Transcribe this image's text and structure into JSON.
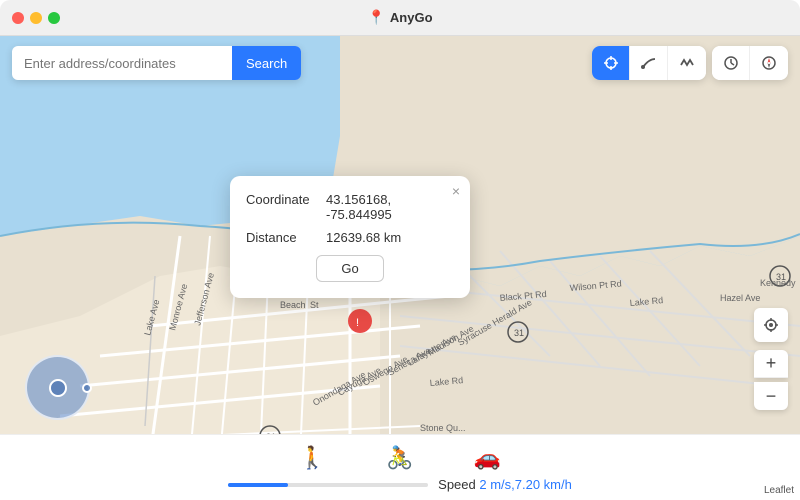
{
  "titleBar": {
    "title": "AnyGo",
    "pinIcon": "📍"
  },
  "searchBar": {
    "placeholder": "Enter address/coordinates",
    "searchLabel": "Search"
  },
  "controls": {
    "crosshair": "⊕",
    "route1": "↩",
    "route2": "〜",
    "history": "🕐",
    "compass": "◎",
    "group1Icons": [
      "crosshair",
      "curve",
      "wave"
    ],
    "group2Icons": [
      "clock",
      "compass"
    ]
  },
  "popup": {
    "closeLabel": "×",
    "coordinateLabel": "Coordinate",
    "coordinateValue": "43.156168, -75.844995",
    "distanceLabel": "Distance",
    "distanceValue": "12639.68 km",
    "goLabel": "Go"
  },
  "bottomPanel": {
    "transportModes": [
      {
        "icon": "🚶",
        "name": "walk"
      },
      {
        "icon": "🚴",
        "name": "bike"
      },
      {
        "icon": "🚗",
        "name": "car"
      }
    ],
    "speedLabel": "Speed",
    "speedValue": "2 m/s,7.20 km/h",
    "speedPercent": 30
  },
  "zoomControls": {
    "locateLabel": "⊕",
    "zoomIn": "+",
    "zoomOut": "−"
  },
  "leafletLabel": "Leaflet"
}
